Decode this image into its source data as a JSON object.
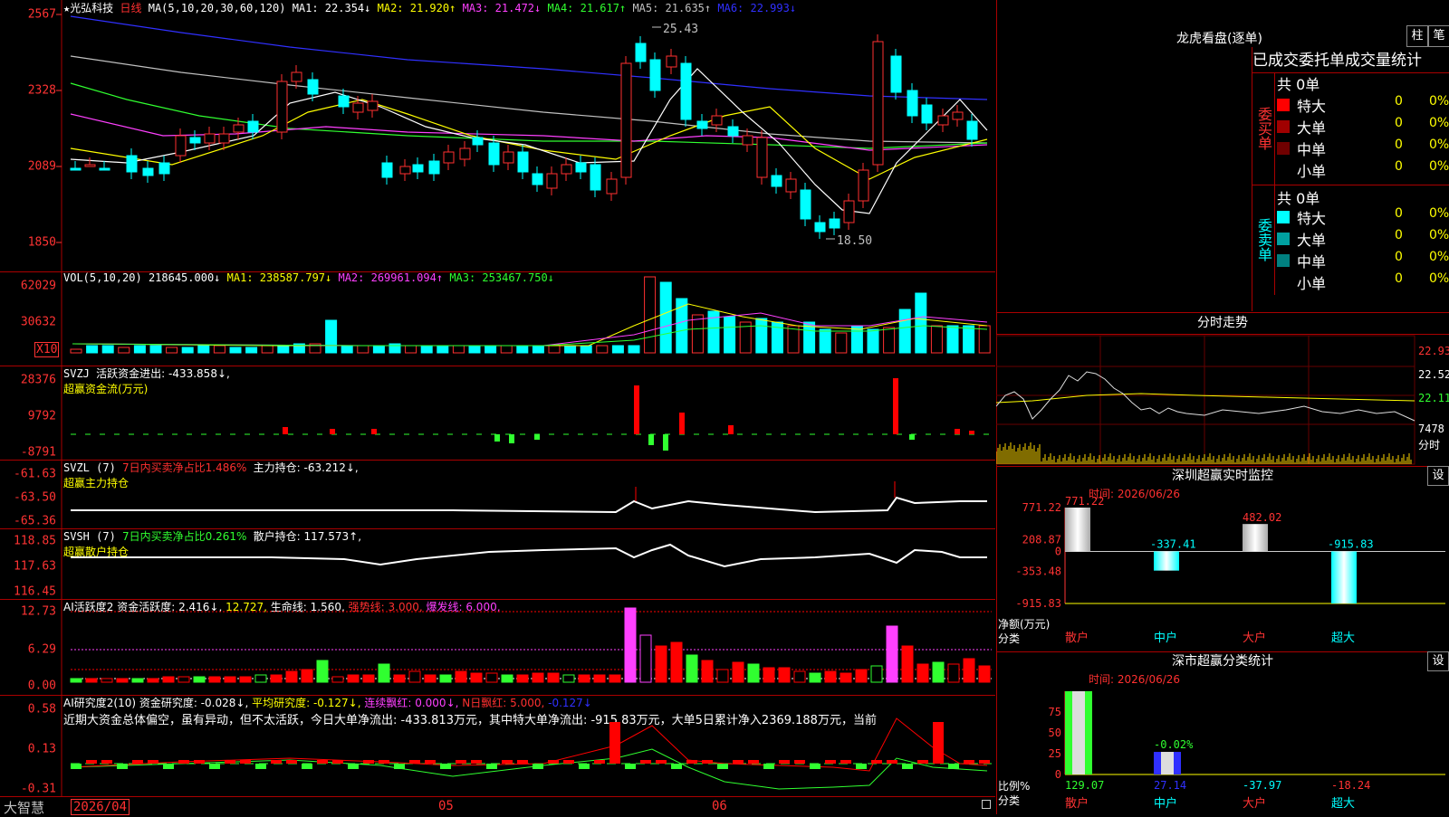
{
  "stock": {
    "star": "★",
    "name": "光弘科技",
    "period": "日线"
  },
  "ma_header": {
    "label": "MA(5,10,20,30,60,120)",
    "ma1": "MA1: 22.354↓",
    "ma2": "MA2: 21.920↑",
    "ma3": "MA3: 21.472↓",
    "ma4": "MA4: 21.617↑",
    "ma5": "MA5: 21.635↑",
    "ma6": "MA6: 22.993↓"
  },
  "price_axis": [
    "2567",
    "2328",
    "2089",
    "1850"
  ],
  "price_marks": {
    "high": "25.43",
    "low": "18.50"
  },
  "vol_header": {
    "label": "VOL(5,10,20)",
    "value": "218645.000↓",
    "ma1": "MA1: 238587.797↓",
    "ma2": "MA2: 269961.094↑",
    "ma3": "MA3: 253467.750↓"
  },
  "vol_axis": [
    "62029",
    "30632"
  ],
  "vol_unit": "X10",
  "svzj": {
    "label": "SVZJ",
    "desc": "活跃资金进出: -433.858↓,",
    "sub": "超赢资金流(万元)",
    "axis": [
      "28376",
      "9792",
      "-8791"
    ]
  },
  "svzl": {
    "label": "SVZL (7)",
    "desc1": "7日内买卖净占比1.486%",
    "desc2": "主力持仓: -63.212↓,",
    "sub": "超赢主力持仓",
    "axis": [
      "-61.63",
      "-63.50",
      "-65.36"
    ]
  },
  "svsh": {
    "label": "SVSH (7)",
    "desc1": "7日内买卖净占比0.261%",
    "desc2": "散户持仓: 117.573↑,",
    "sub": "超赢散户持仓",
    "axis": [
      "118.85",
      "117.63",
      "116.45"
    ]
  },
  "ai_active": {
    "label": "AI活跃度2",
    "desc": "资金活跃度: 2.416↓,",
    "v2": "12.727,",
    "life": "生命线: 1.560,",
    "strong": "强势线: 3.000,",
    "burst": "爆发线: 6.000,",
    "axis": [
      "12.73",
      "6.29",
      "0.00"
    ]
  },
  "ai_research": {
    "label": "AI研究度2(10)",
    "desc": "资金研究度: -0.028↓,",
    "avg": "平均研究度: -0.127↓,",
    "lh": "连续飘红: 0.000↓,",
    "nh": "N日飘红: 5.000,",
    "last": "-0.127↓",
    "text": "近期大资金总体偏空，虽有异动，但不太活跃，今日大单净流出: -433.813万元，其中特大单净流出: -915.83万元，大单5日累计净入2369.188万元，当前",
    "axis": [
      "0.58",
      "0.13",
      "-0.31"
    ]
  },
  "date_axis": [
    "2026/04",
    "05",
    "06"
  ],
  "brand": "大智慧",
  "lhb": {
    "title": "龙虎看盘(逐单)",
    "btn1": "柱",
    "btn2": "笔",
    "table_title": "已成交委托单成交量统计",
    "buy": {
      "side": "委买单",
      "total": "共 0单",
      "rows": [
        {
          "label": "特大",
          "v": "0",
          "p": "0%",
          "color": "#ff0000"
        },
        {
          "label": "大单",
          "v": "0",
          "p": "0%",
          "color": "#a00000"
        },
        {
          "label": "中单",
          "v": "0",
          "p": "0%",
          "color": "#700000"
        },
        {
          "label": "小单",
          "v": "0",
          "p": "0%",
          "color": "#000000"
        }
      ]
    },
    "sell": {
      "side": "委卖单",
      "total": "共 0单",
      "rows": [
        {
          "label": "特大",
          "v": "0",
          "p": "0%",
          "color": "#00ffff"
        },
        {
          "label": "大单",
          "v": "0",
          "p": "0%",
          "color": "#00a0a0"
        },
        {
          "label": "中单",
          "v": "0",
          "p": "0%",
          "color": "#008080"
        },
        {
          "label": "小单",
          "v": "0",
          "p": "0%",
          "color": "#000000"
        }
      ]
    }
  },
  "intraday": {
    "title": "分时走势",
    "axis": [
      "22.93",
      "22.52",
      "22.11"
    ],
    "vol": "7478",
    "unit": "分时"
  },
  "sz_monitor": {
    "title": "深圳超赢实时监控",
    "btn": "设",
    "time": "时间: 2026/06/26",
    "axis": [
      "771.22",
      "208.87",
      "0",
      "-353.48",
      "-915.83"
    ],
    "ylabel": "净额(万元)",
    "xlabel": "分类",
    "bars": [
      {
        "cat": "散户",
        "value": 771.22,
        "label": "771.22"
      },
      {
        "cat": "中户",
        "value": -337.41,
        "label": "-337.41"
      },
      {
        "cat": "大户",
        "value": 482.02,
        "label": "482.02"
      },
      {
        "cat": "超大",
        "value": -915.83,
        "label": "-915.83"
      }
    ]
  },
  "sz_class": {
    "title": "深市超赢分类统计",
    "btn": "设",
    "time": "时间: 2026/06/26",
    "axis": [
      "75",
      "50",
      "25",
      "0"
    ],
    "ylabel": "比例%",
    "xlabel": "分类",
    "bars": [
      {
        "cat": "散户",
        "value": 129.07,
        "label": "129.07"
      },
      {
        "cat": "中户",
        "value": 27.14,
        "label": "27.14",
        "top": "-0.02%"
      },
      {
        "cat": "大户",
        "value": -37.97,
        "label": "-37.97"
      },
      {
        "cat": "超大",
        "value": -18.24,
        "label": "-18.24"
      }
    ]
  }
}
